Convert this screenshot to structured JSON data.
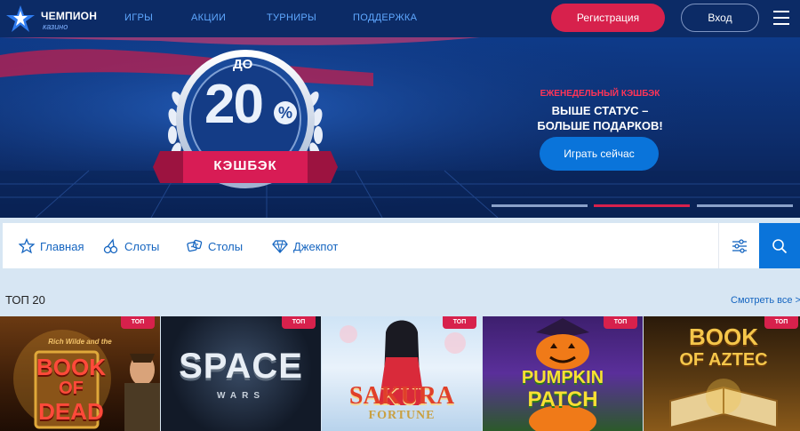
{
  "header": {
    "logo_title": "ЧЕМПИОН",
    "logo_subtitle": "казино",
    "nav": [
      "ИГРЫ",
      "АКЦИИ",
      "ТУРНИРЫ",
      "ПОДДЕРЖКА"
    ],
    "register_label": "Регистрация",
    "login_label": "Вход"
  },
  "banner": {
    "badge_prefix": "ДО",
    "badge_value": "20",
    "badge_percent": "%",
    "badge_ribbon": "КЭШБЭК",
    "promo_small": "ЕЖЕНЕДЕЛЬНЫЙ КЭШБЭК",
    "promo_line1": "ВЫШЕ СТАТУС –",
    "promo_line2": "БОЛЬШЕ ПОДАРКОВ!",
    "cta_label": "Играть сейчас",
    "slides_total": 3,
    "slide_active": 2
  },
  "categories": [
    {
      "label": "Главная",
      "icon": "star-icon"
    },
    {
      "label": "Слоты",
      "icon": "cherries-icon"
    },
    {
      "label": "Столы",
      "icon": "dice-icon"
    },
    {
      "label": "Джекпот",
      "icon": "diamond-icon"
    }
  ],
  "top": {
    "title": "ТОП 20",
    "see_all": "Смотреть все >",
    "badge": "ТОП",
    "games": [
      {
        "title": "BOOK OF DEAD",
        "line1": "Rich Wilde and the",
        "line2": "BOOK",
        "line3": "OF",
        "line4": "DEAD"
      },
      {
        "title": "SPACE WARS",
        "line1": "SPACE",
        "line2": "WARS"
      },
      {
        "title": "SAKURA FORTUNE",
        "line1": "SAKURA",
        "line2": "FORTUNE"
      },
      {
        "title": "PUMPKIN PATCH",
        "line1": "PUMPKIN",
        "line2": "PATCH"
      },
      {
        "title": "BOOK OF AZTEC",
        "line1": "BOOK",
        "line2": "OF AZTEC"
      }
    ]
  },
  "colors": {
    "header_bg": "#0c2b66",
    "accent_red": "#d7214c",
    "accent_blue": "#0a74da",
    "page_bg": "#d7e6f3"
  }
}
